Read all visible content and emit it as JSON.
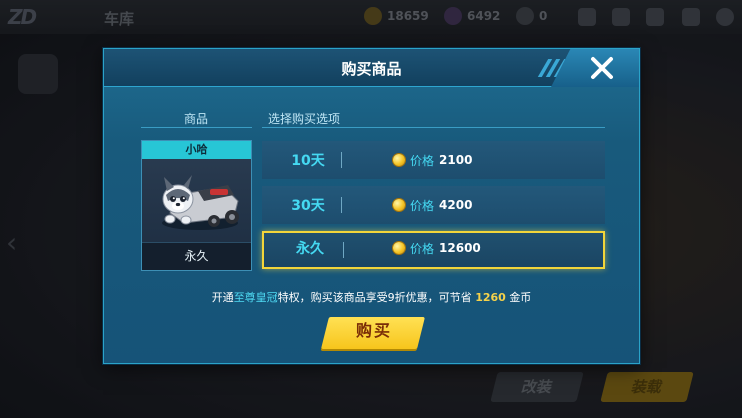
{
  "background": {
    "title": "车库",
    "currencies": [
      {
        "value": "18659",
        "color": "#e0b93a"
      },
      {
        "value": "6492",
        "color": "#8a5cc9"
      },
      {
        "value": "0",
        "color": "#6f7680"
      }
    ],
    "buttons": [
      {
        "label": "改装",
        "color": "#3b3f47"
      },
      {
        "label": "装载",
        "color": "#d9a81c"
      }
    ]
  },
  "modal": {
    "title": "购买商品",
    "close_icon": "close-icon",
    "col_item_label": "商品",
    "col_options_label": "选择购买选项",
    "item": {
      "name": "小哈",
      "duration": "永久",
      "image": "husky-kart-icon"
    },
    "options": [
      {
        "duration": "10天",
        "price_label": "价格",
        "price": "2100",
        "selected": false
      },
      {
        "duration": "30天",
        "price_label": "价格",
        "price": "4200",
        "selected": false
      },
      {
        "duration": "永久",
        "price_label": "价格",
        "price": "12600",
        "selected": true
      }
    ],
    "promo": {
      "part1": "开通",
      "privilege": "至尊皇冠",
      "part2": "特权，购买该商品享受9折优惠，可节省",
      "saving": "1260",
      "part3": "金币"
    },
    "buy_label": "购买"
  }
}
